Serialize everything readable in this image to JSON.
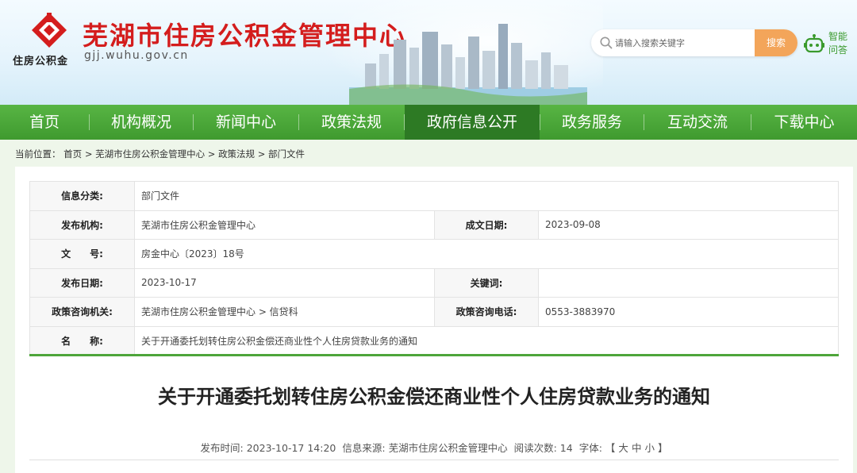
{
  "header": {
    "logo_text": "住房公积金",
    "site_title": "芜湖市住房公积金管理中心",
    "domain": "gjj.wuhu.gov.cn",
    "search_placeholder": "请输入搜索关键字",
    "search_button": "搜索",
    "qa_label": "智能问答"
  },
  "nav": {
    "items": [
      {
        "label": "首页"
      },
      {
        "label": "机构概况"
      },
      {
        "label": "新闻中心"
      },
      {
        "label": "政策法规"
      },
      {
        "label": "政府信息公开"
      },
      {
        "label": "政务服务"
      },
      {
        "label": "互动交流"
      },
      {
        "label": "下载中心"
      }
    ],
    "active": "政府信息公开"
  },
  "breadcrumb": {
    "prefix": "当前位置：",
    "items": [
      "首页",
      "芜湖市住房公积金管理中心",
      "政策法规",
      "部门文件"
    ],
    "separator": ">"
  },
  "info": {
    "category_label": "信息分类:",
    "category_value": "部门文件",
    "publisher_label": "发布机构:",
    "publisher_value": "芜湖市住房公积金管理中心",
    "created_label": "成文日期:",
    "created_value": "2023-09-08",
    "docno_label": "文　　号:",
    "docno_value": "房金中心〔2023〕18号",
    "pubdate_label": "发布日期:",
    "pubdate_value": "2023-10-17",
    "keywords_label": "关键词:",
    "keywords_value": "",
    "consult_org_label": "政策咨询机关:",
    "consult_org_value": "芜湖市住房公积金管理中心 > 信贷科",
    "consult_tel_label": "政策咨询电话:",
    "consult_tel_value": "0553-3883970",
    "name_label": "名　　称:",
    "name_value": "关于开通委托划转住房公积金偿还商业性个人住房贷款业务的通知"
  },
  "article": {
    "title": "关于开通委托划转住房公积金偿还商业性个人住房贷款业务的通知",
    "publish_time_label": "发布时间:",
    "publish_time": "2023-10-17 14:20",
    "source_label": "信息来源:",
    "source": "芜湖市住房公积金管理中心",
    "views_label": "阅读次数:",
    "views": "14",
    "font_label": "字体:",
    "font_open": "【",
    "font_large": "大",
    "font_medium": "中",
    "font_small": "小",
    "font_close": "】"
  },
  "colors": {
    "brand_red": "#d41d1d",
    "nav_green": "#4ea53a",
    "nav_active": "#2d7a24",
    "search_orange": "#f3a55a"
  }
}
